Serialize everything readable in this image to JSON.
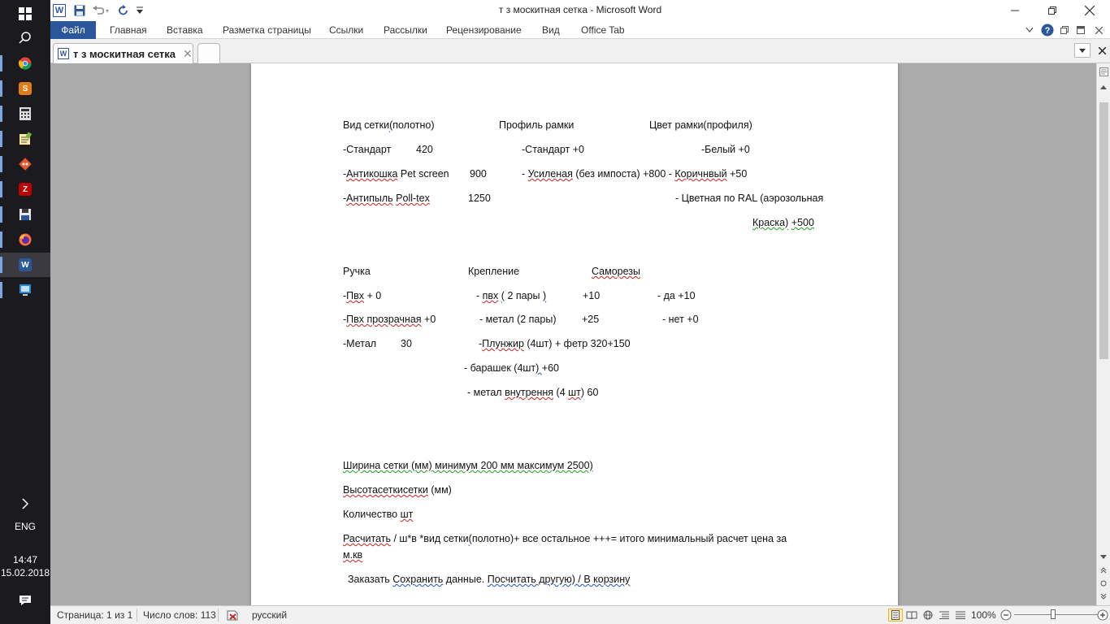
{
  "taskbar": {
    "language": "ENG",
    "time": "14:47",
    "date": "15.02.2018"
  },
  "window": {
    "title": "т з москитная сетка - Microsoft Word"
  },
  "ribbon": {
    "tabs": [
      "Файл",
      "Главная",
      "Вставка",
      "Разметка страницы",
      "Ссылки",
      "Рассылки",
      "Рецензирование",
      "Вид",
      "Office Tab"
    ]
  },
  "doc_tab": {
    "label": "т з москитная сетка"
  },
  "document": {
    "row1": {
      "h1": "Вид сетки(полотно)",
      "h2": "Профиль рамки",
      "h3": "Цвет рамки(профиля)"
    },
    "c1": [
      "-Стандарт",
      "420",
      "-Антикошка Pet screen",
      "900",
      "-Антипыль  Poll-tex",
      "1250"
    ],
    "c2": [
      "-Стандарт    +0",
      "- Усиленая (без импоста)    +800    -",
      "Коричнвый +50"
    ],
    "c3": [
      "-Белый  +0",
      "- Цветная по    RAL (аэрозольная",
      "Краска)    +500"
    ],
    "row2": {
      "h1": "Ручка",
      "h2": "Крепление",
      "h3": "Саморезы"
    },
    "handle": [
      "-Пвх     + 0",
      "-Пвх прозрачная +0",
      "-Метал",
      "30"
    ],
    "mount": [
      "- пвх  ( 2 пары  )",
      "+10",
      "- метал     (2 пары)",
      "+25",
      "-Плунжир (4шт) + фетр 320+150",
      "- барашек (4шт)  +60",
      "- метал внутрення (4 шт) 60"
    ],
    "screws": [
      "- да  +10",
      "- нет  +0"
    ],
    "width_line": "Ширина сетки (мм)     минимум 200  мм максимум 2500)",
    "height_line": "Высотасеткисетки (мм)",
    "qty_line": "Количество  шт",
    "calc_line1": "Расчитать    /  ш*в *вид сетки(полотно)+ все остальное +++= итого минимальный расчет цена за",
    "calc_line2": "м.кв",
    "order_line": "Заказать  Сохранить данные. Посчитать другую) / В корзину"
  },
  "statusbar": {
    "page": "Страница: 1 из 1",
    "words": "Число слов: 113",
    "language": "русский",
    "zoom": "100%"
  }
}
